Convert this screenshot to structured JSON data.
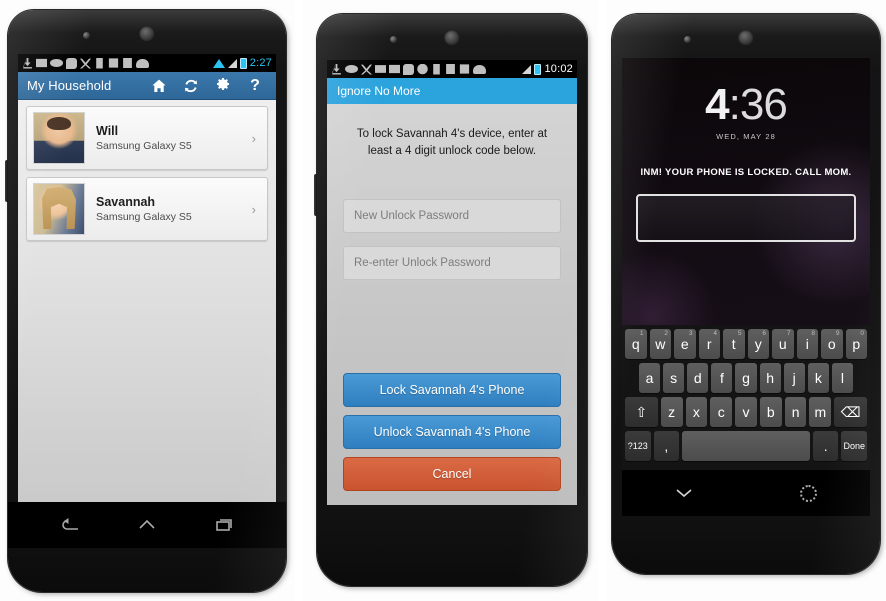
{
  "panels": {
    "phone1": {
      "statusbar": {
        "time": "2:27",
        "icons": [
          "download-icon",
          "mail-icon",
          "voicemail-icon",
          "chat-icon",
          "missed-call-icon",
          "sdcard-icon",
          "checklist-icon",
          "play-store-icon",
          "android-icon"
        ],
        "wifi": "wifi-icon",
        "signal": "signal-icon",
        "battery": "battery-icon"
      },
      "actionbar": {
        "title": "My Household",
        "actions": [
          {
            "name": "home-icon",
            "label": "Home"
          },
          {
            "name": "refresh-icon",
            "label": "Refresh"
          },
          {
            "name": "settings-gear-icon",
            "label": "Settings"
          },
          {
            "name": "help-icon",
            "label": "?"
          }
        ]
      },
      "list": [
        {
          "name": "Will",
          "device": "Samsung Galaxy S5",
          "chevron": "›"
        },
        {
          "name": "Savannah",
          "device": "Samsung Galaxy S5",
          "chevron": "›"
        }
      ],
      "nav": [
        "back-nav-icon",
        "home-nav-icon",
        "recents-nav-icon"
      ]
    },
    "phone2": {
      "statusbar": {
        "time": "10:02"
      },
      "title": "Ignore No More",
      "message": "To lock Savannah 4's device, enter at least a 4 digit unlock code below.",
      "fields": [
        {
          "placeholder": "New Unlock Password",
          "value": ""
        },
        {
          "placeholder": "Re-enter Unlock Password",
          "value": ""
        }
      ],
      "buttons": [
        {
          "label": "Lock Savannah 4's Phone",
          "style": "blue"
        },
        {
          "label": "Unlock Savannah 4's Phone",
          "style": "blue"
        },
        {
          "label": "Cancel",
          "style": "orange"
        }
      ]
    },
    "phone3": {
      "lock": {
        "hour": "4",
        "minute": ":36",
        "date": "WED, MAY 28",
        "message": "INM! YOUR PHONE IS LOCKED. CALL MOM.",
        "input_value": ""
      },
      "keyboard": {
        "row1": [
          {
            "k": "q",
            "hint": "1"
          },
          {
            "k": "w",
            "hint": "2"
          },
          {
            "k": "e",
            "hint": "3"
          },
          {
            "k": "r",
            "hint": "4"
          },
          {
            "k": "t",
            "hint": "5"
          },
          {
            "k": "y",
            "hint": "6"
          },
          {
            "k": "u",
            "hint": "7"
          },
          {
            "k": "i",
            "hint": "8"
          },
          {
            "k": "o",
            "hint": "9"
          },
          {
            "k": "p",
            "hint": "0"
          }
        ],
        "row2": [
          "a",
          "s",
          "d",
          "f",
          "g",
          "h",
          "j",
          "k",
          "l"
        ],
        "row3": [
          "z",
          "x",
          "c",
          "v",
          "b",
          "n",
          "m"
        ],
        "shift": "⇧",
        "backspace": "⌫",
        "symbols": "?123",
        "comma": ",",
        "space": "",
        "period": ".",
        "done": "Done"
      },
      "nav": [
        "hide-keyboard-icon",
        "home-dots-icon"
      ]
    }
  },
  "colors": {
    "actionbar_blue": "#2e6798",
    "dialog_titlebar_blue": "#2ba3dd",
    "button_blue": "#2f7fc0",
    "button_orange": "#c9532f",
    "status_accent": "#2bc4f3"
  }
}
